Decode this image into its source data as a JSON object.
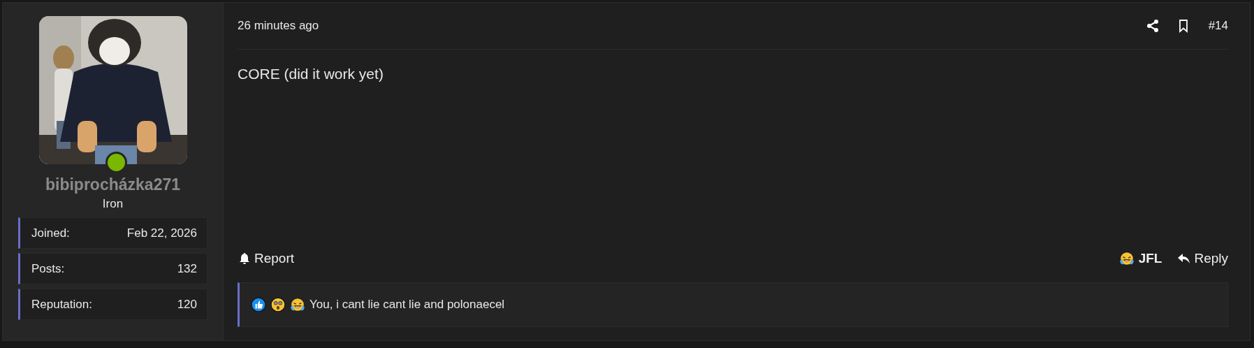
{
  "author": {
    "name": "bibiprocházka271",
    "online": true,
    "rank": "Iron",
    "stats": [
      {
        "label": "Joined:",
        "value": "Feb 22, 2026"
      },
      {
        "label": "Posts:",
        "value": "132"
      },
      {
        "label": "Reputation:",
        "value": "120"
      }
    ]
  },
  "post": {
    "time": "26 minutes ago",
    "number": "#14",
    "body": "CORE (did it work yet)",
    "actions_left": [
      {
        "kind": "report",
        "label": "Report"
      }
    ],
    "actions_right": [
      {
        "kind": "reaction",
        "label": "JFL"
      },
      {
        "kind": "reply",
        "label": "Reply"
      }
    ],
    "reactions": {
      "icons": [
        {
          "kind": "like"
        },
        {
          "kind": "wow"
        },
        {
          "kind": "haha"
        }
      ],
      "text": "You, i cant lie cant lie and polonaecel"
    }
  }
}
